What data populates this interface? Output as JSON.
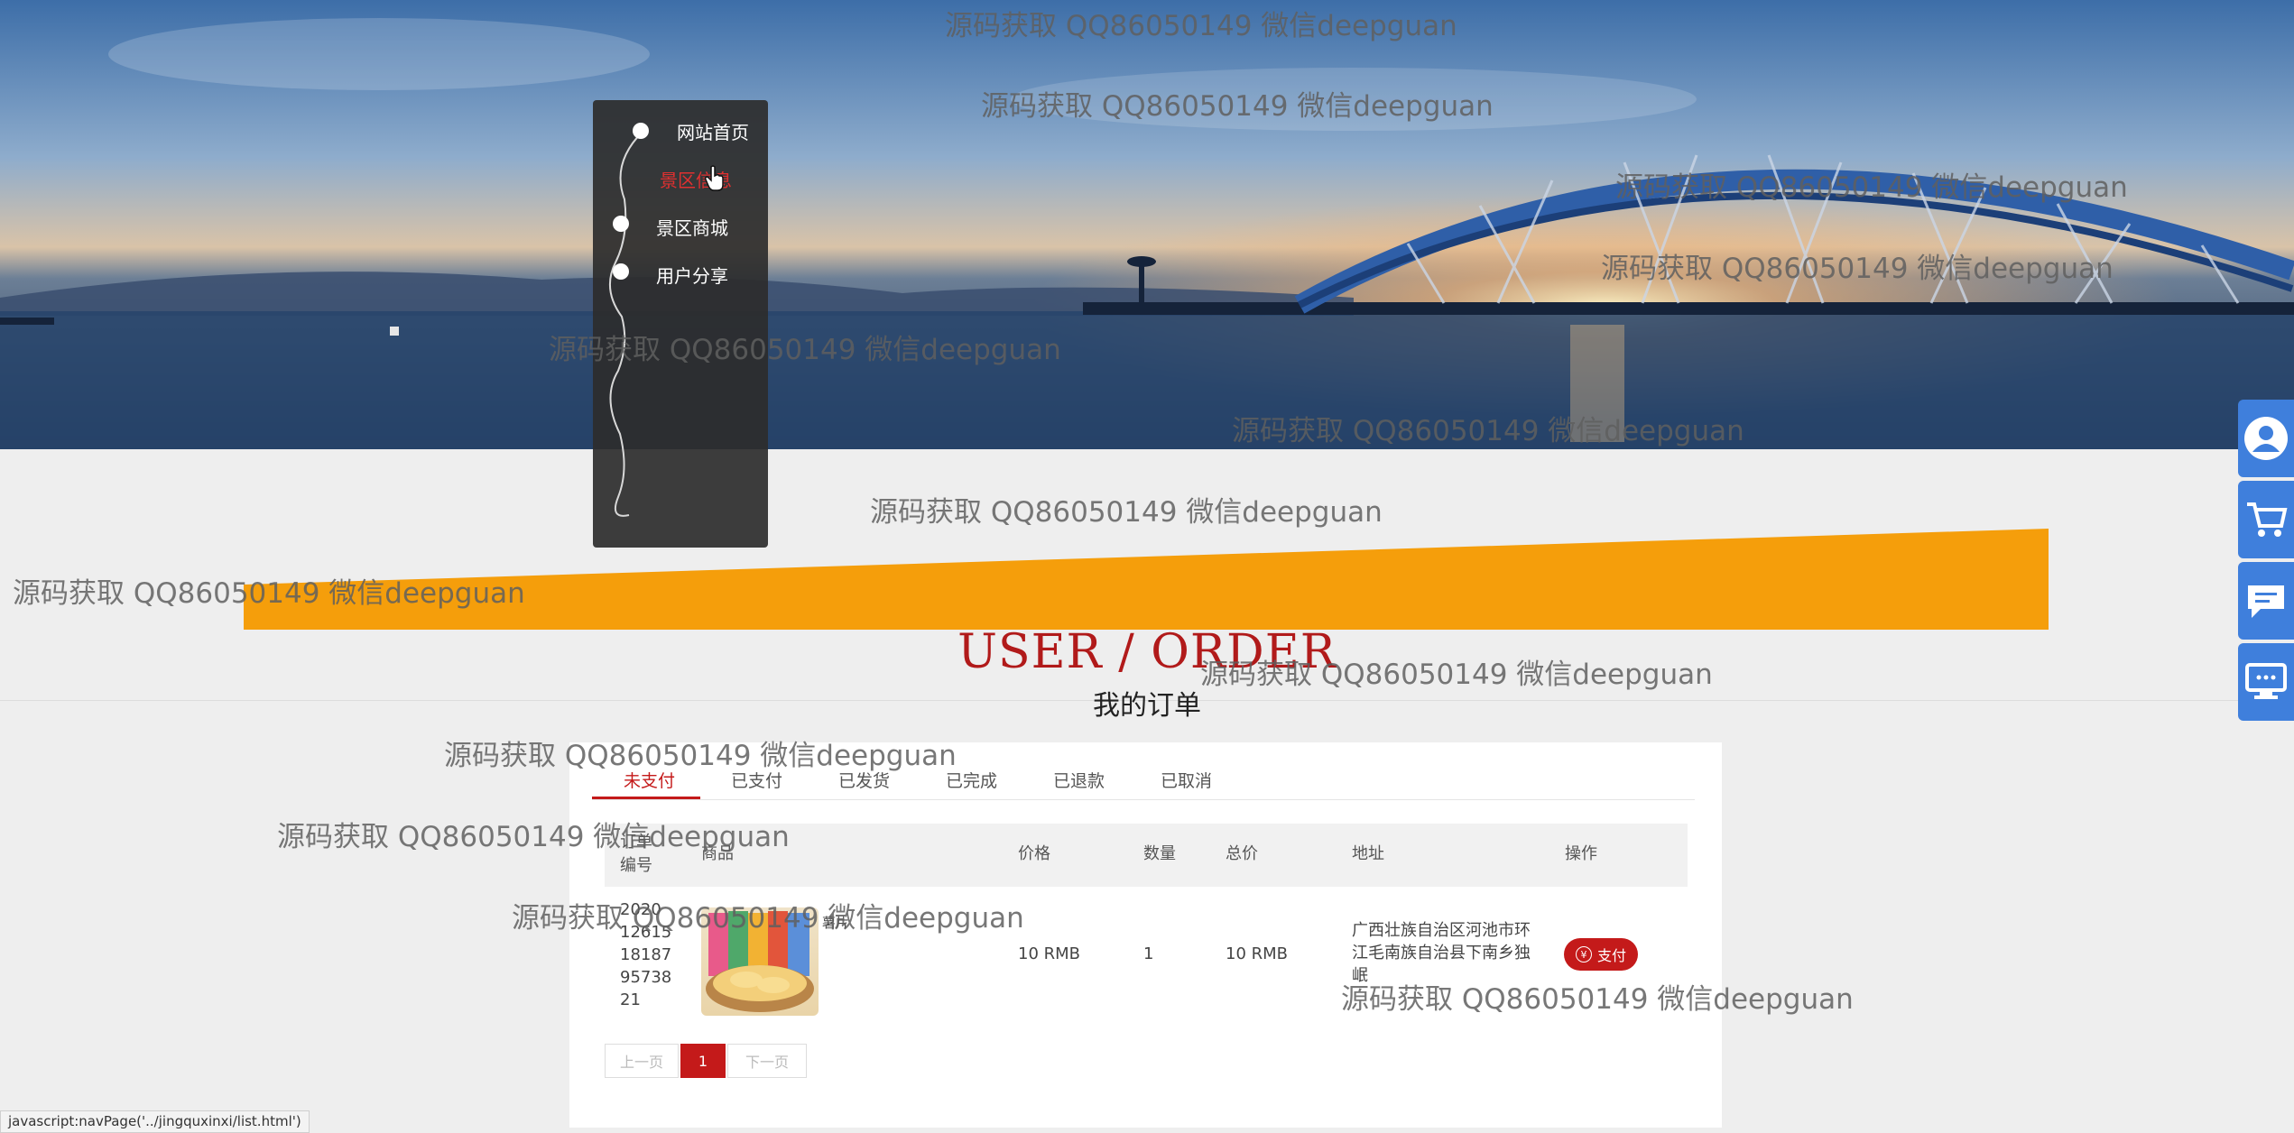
{
  "nav": {
    "items": [
      {
        "label": "网站首页",
        "active": false
      },
      {
        "label": "景区信息",
        "active": true
      },
      {
        "label": "景区商城",
        "active": false
      },
      {
        "label": "用户分享",
        "active": false
      }
    ]
  },
  "page": {
    "title_en": "USER / ORDER",
    "title_cn": "我的订单"
  },
  "tabs": [
    "未支付",
    "已支付",
    "已发货",
    "已完成",
    "已退款",
    "已取消"
  ],
  "table": {
    "headers": {
      "order_no": "订单编号",
      "product": "商品",
      "price": "价格",
      "qty": "数量",
      "total": "总价",
      "address": "地址",
      "action": "操作"
    },
    "rows": [
      {
        "order_no": "2020126151818795738 21",
        "order_no_lines": [
          "2020",
          "12615",
          "18187",
          "95738",
          "21"
        ],
        "product_name": "薯片",
        "price": "10 RMB",
        "qty": "1",
        "total": "10 RMB",
        "address_lines": [
          "广西壮族自治区河池市环",
          "江毛南族自治县下南乡独",
          "岷"
        ],
        "pay_label": "支付",
        "pay_icon": "¥"
      }
    ]
  },
  "pager": {
    "prev": "上一页",
    "current": "1",
    "next": "下一页"
  },
  "status_url": "javascript:navPage('../jingquxinxi/list.html')",
  "watermark": "源码获取 QQ86050149 微信deepguan",
  "colors": {
    "accent": "#c41a1a",
    "band": "#f59e0b",
    "sidebar": "#3f7fdc"
  },
  "sidebar_icons": [
    "user-icon",
    "cart-icon",
    "message-icon",
    "monitor-icon"
  ]
}
